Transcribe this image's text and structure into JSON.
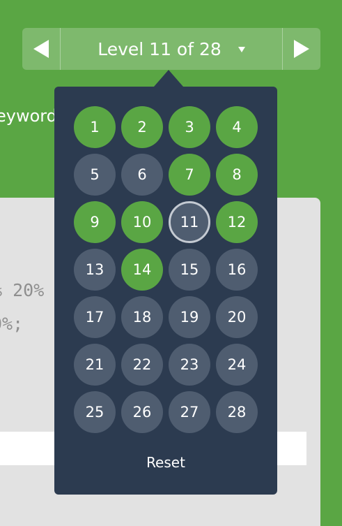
{
  "nav": {
    "prev_icon": "triangle-left-icon",
    "next_icon": "triangle-right-icon",
    "level_label": "Level 11 of 28",
    "caret_icon": "caret-down-icon"
  },
  "background": {
    "keyword_fragment": "eyword",
    "code_line1": "% 20%",
    "code_line2": "0%;"
  },
  "popup": {
    "levels": [
      {
        "number": "1",
        "state": "solved"
      },
      {
        "number": "2",
        "state": "solved"
      },
      {
        "number": "3",
        "state": "solved"
      },
      {
        "number": "4",
        "state": "solved"
      },
      {
        "number": "5",
        "state": "unsolved"
      },
      {
        "number": "6",
        "state": "unsolved"
      },
      {
        "number": "7",
        "state": "solved"
      },
      {
        "number": "8",
        "state": "solved"
      },
      {
        "number": "9",
        "state": "solved"
      },
      {
        "number": "10",
        "state": "solved"
      },
      {
        "number": "11",
        "state": "current"
      },
      {
        "number": "12",
        "state": "solved"
      },
      {
        "number": "13",
        "state": "unsolved"
      },
      {
        "number": "14",
        "state": "solved"
      },
      {
        "number": "15",
        "state": "unsolved"
      },
      {
        "number": "16",
        "state": "unsolved"
      },
      {
        "number": "17",
        "state": "unsolved"
      },
      {
        "number": "18",
        "state": "unsolved"
      },
      {
        "number": "19",
        "state": "unsolved"
      },
      {
        "number": "20",
        "state": "unsolved"
      },
      {
        "number": "21",
        "state": "unsolved"
      },
      {
        "number": "22",
        "state": "unsolved"
      },
      {
        "number": "23",
        "state": "unsolved"
      },
      {
        "number": "24",
        "state": "unsolved"
      },
      {
        "number": "25",
        "state": "unsolved"
      },
      {
        "number": "26",
        "state": "unsolved"
      },
      {
        "number": "27",
        "state": "unsolved"
      },
      {
        "number": "28",
        "state": "unsolved"
      }
    ],
    "reset_label": "Reset"
  },
  "colors": {
    "brand_green": "#5aa644",
    "popup_bg": "#2c3b50",
    "unsolved": "#4f5d70",
    "current_ring": "#c4cad2"
  }
}
